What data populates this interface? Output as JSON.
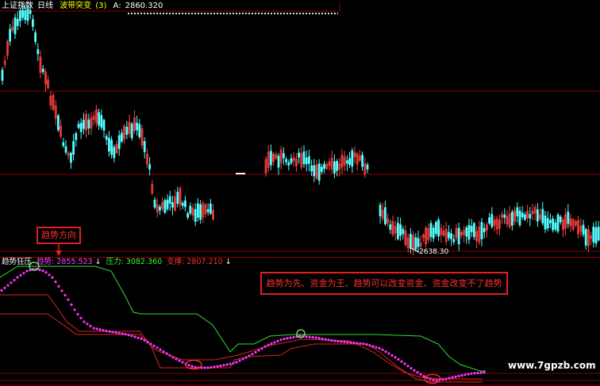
{
  "header": {
    "index_name": "上证指数",
    "period": "日线",
    "indicator": "波带突变",
    "indicator_param": "(3)",
    "value_label": "A:",
    "value": "2860.320"
  },
  "low_label": "2638.30",
  "indicator_panel": {
    "name": "趋势狂压",
    "trend_label": "趋势:",
    "trend_value": "2855.523",
    "trend_arrow": "↓",
    "pressure_label": "压力:",
    "pressure_value": "3082.360",
    "support_label": "支撑:",
    "support_value": "2807.210",
    "support_arrow": "↓"
  },
  "annotations": {
    "direction_box": "趋势方向",
    "motto_box": "趋势为先、资金为王、趋势可以改变资金、资金改变不了趋势"
  },
  "watermark": "www.7gpzb.com",
  "colors": {
    "background": "#000000",
    "up_candle": "#ff4040",
    "down_candle": "#54ffff",
    "trend_line": "#ff33ff",
    "pressure_line": "#33dd33",
    "support_line": "#dd2222",
    "grid": "#880000",
    "annotation": "#e02020"
  }
}
